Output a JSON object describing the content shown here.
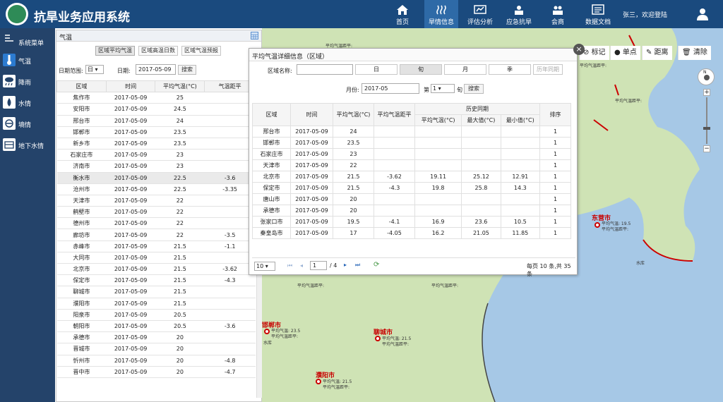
{
  "header": {
    "app_title": "抗旱业务应用系统",
    "nav": [
      {
        "label": "首页",
        "icon": "home-icon"
      },
      {
        "label": "旱情信息",
        "icon": "drought-info-icon"
      },
      {
        "label": "评估分析",
        "icon": "analysis-icon"
      },
      {
        "label": "应急抗旱",
        "icon": "emergency-icon"
      },
      {
        "label": "会商",
        "icon": "consultation-icon"
      },
      {
        "label": "数据文档",
        "icon": "documents-icon"
      }
    ],
    "user_text": "张三，欢迎登陆"
  },
  "sidebar": {
    "menu_title": "系统菜单",
    "items": [
      {
        "label": "气温",
        "icon": "thermometer-icon"
      },
      {
        "label": "降雨",
        "icon": "rain-icon"
      },
      {
        "label": "水情",
        "icon": "water-drop-icon"
      },
      {
        "label": "墒情",
        "icon": "soil-moisture-icon"
      },
      {
        "label": "地下水情",
        "icon": "groundwater-icon"
      }
    ]
  },
  "left_panel": {
    "title": "气温",
    "tabs": [
      "区域平均气温",
      "区域高温日数",
      "区域气温预报"
    ],
    "range_label": "日期范围:",
    "range_value": "日",
    "date_label": "日期:",
    "date_value": "2017-05-09",
    "search_label": "搜索",
    "columns": [
      "区域",
      "时间",
      "平均气温(°C)",
      "气温距平"
    ],
    "rows": [
      [
        "焦作市",
        "2017-05-09",
        "25",
        ""
      ],
      [
        "安阳市",
        "2017-05-09",
        "24.5",
        ""
      ],
      [
        "邢台市",
        "2017-05-09",
        "24",
        ""
      ],
      [
        "邯郸市",
        "2017-05-09",
        "23.5",
        ""
      ],
      [
        "新乡市",
        "2017-05-09",
        "23.5",
        ""
      ],
      [
        "石家庄市",
        "2017-05-09",
        "23",
        ""
      ],
      [
        "济南市",
        "2017-05-09",
        "23",
        ""
      ],
      [
        "衡水市",
        "2017-05-09",
        "22.5",
        "-3.6"
      ],
      [
        "沧州市",
        "2017-05-09",
        "22.5",
        "-3.35"
      ],
      [
        "天津市",
        "2017-05-09",
        "22",
        ""
      ],
      [
        "鹤壁市",
        "2017-05-09",
        "22",
        ""
      ],
      [
        "德州市",
        "2017-05-09",
        "22",
        ""
      ],
      [
        "廊坊市",
        "2017-05-09",
        "22",
        "-3.5"
      ],
      [
        "赤峰市",
        "2017-05-09",
        "21.5",
        "-1.1"
      ],
      [
        "大同市",
        "2017-05-09",
        "21.5",
        ""
      ],
      [
        "北京市",
        "2017-05-09",
        "21.5",
        "-3.62"
      ],
      [
        "保定市",
        "2017-05-09",
        "21.5",
        "-4.3"
      ],
      [
        "聊城市",
        "2017-05-09",
        "21.5",
        ""
      ],
      [
        "濮阳市",
        "2017-05-09",
        "21.5",
        ""
      ],
      [
        "阳泉市",
        "2017-05-09",
        "20.5",
        ""
      ],
      [
        "朝阳市",
        "2017-05-09",
        "20.5",
        "-3.6"
      ],
      [
        "承德市",
        "2017-05-09",
        "20",
        ""
      ],
      [
        "晋城市",
        "2017-05-09",
        "20",
        ""
      ],
      [
        "忻州市",
        "2017-05-09",
        "20",
        "-4.8"
      ],
      [
        "晋中市",
        "2017-05-09",
        "20",
        "-4.7"
      ]
    ]
  },
  "popup": {
    "title": "平均气温详细信息（区域）",
    "region_label": "区域名称:",
    "region_value": "",
    "period_tabs": [
      "日",
      "旬",
      "月",
      "季",
      "历年同期"
    ],
    "month_label": "月份:",
    "month_value": "2017-05",
    "di_label": "第",
    "di_value": "1",
    "xun_label": "旬",
    "search_label": "搜索",
    "columns": [
      "区域",
      "时间",
      "平均气温(°C)",
      "平均气温距平",
      "历史同期",
      "排序"
    ],
    "sub_columns": [
      "平均气温(°C)",
      "最大值(°C)",
      "最小值(°C)"
    ],
    "rows": [
      [
        "邢台市",
        "2017-05-09",
        "24",
        "",
        "",
        "",
        "",
        "1"
      ],
      [
        "邯郸市",
        "2017-05-09",
        "23.5",
        "",
        "",
        "",
        "",
        "1"
      ],
      [
        "石家庄市",
        "2017-05-09",
        "23",
        "",
        "",
        "",
        "",
        "1"
      ],
      [
        "天津市",
        "2017-05-09",
        "22",
        "",
        "",
        "",
        "",
        "1"
      ],
      [
        "北京市",
        "2017-05-09",
        "21.5",
        "-3.62",
        "19.11",
        "25.12",
        "12.91",
        "1"
      ],
      [
        "保定市",
        "2017-05-09",
        "21.5",
        "-4.3",
        "19.8",
        "25.8",
        "14.3",
        "1"
      ],
      [
        "唐山市",
        "2017-05-09",
        "20",
        "",
        "",
        "",
        "",
        "1"
      ],
      [
        "承德市",
        "2017-05-09",
        "20",
        "",
        "",
        "",
        "",
        "1"
      ],
      [
        "张家口市",
        "2017-05-09",
        "19.5",
        "-4.1",
        "16.9",
        "23.6",
        "10.5",
        "1"
      ],
      [
        "秦皇岛市",
        "2017-05-09",
        "17",
        "-4.05",
        "16.2",
        "21.05",
        "11.85",
        "1"
      ]
    ],
    "page_size": "10",
    "current_page": "1",
    "total_pages": "/ 4",
    "summary": "每页 10 条,共 35 条"
  },
  "map": {
    "tools": [
      "标记",
      "单点",
      "距离",
      "清除"
    ],
    "compass_label": "N",
    "labels": [
      {
        "name": "东营市",
        "info": "平均气温: 19.5\n平均气温距平:"
      },
      {
        "name": "邯郸市",
        "info": "平均气温: 23.5\n平均气温距平:"
      },
      {
        "name": "聊城市",
        "info": "平均气温: 21.5\n平均气温距平:"
      },
      {
        "name": "濮阳市",
        "info": "平均气温: 21.5\n平均气温距平:"
      }
    ],
    "reservoir_label": "水库",
    "reservoir_label_2": "水库",
    "small_labels": [
      "平均气温距平:",
      "平均气温距平:",
      "平均气温距平:",
      "平均气温距平:",
      "平均气温距平:"
    ]
  },
  "colors": {
    "header_bg": "#1a4a7e",
    "sidebar_bg": "#24436a",
    "nav_active": "#2e6aa7",
    "city_red": "#c80000",
    "map_land": "#cfe3b5",
    "map_sea": "#a6c8e6"
  }
}
